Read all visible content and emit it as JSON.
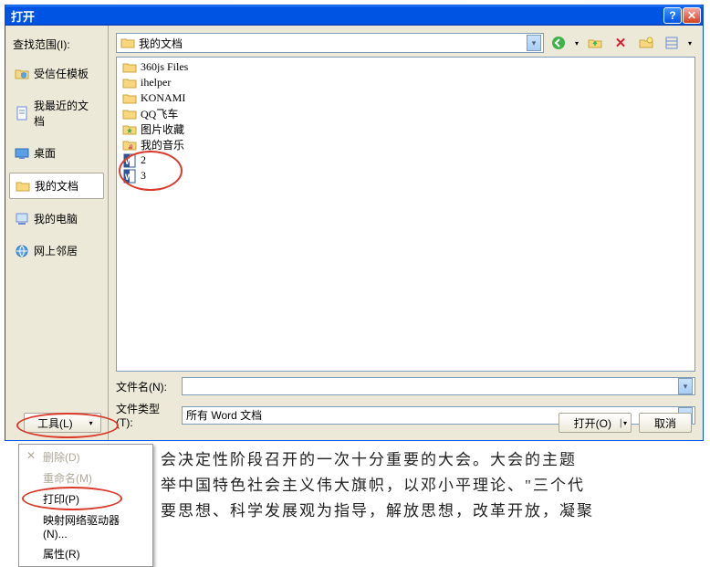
{
  "title": "打开",
  "lookup_label": "查找范围(I):",
  "location": "我的文档",
  "left_items": [
    {
      "name": "trusted-templates",
      "label": "受信任模板",
      "icon": "folder-shield"
    },
    {
      "name": "recent-docs",
      "label": "我最近的文档",
      "icon": "doc"
    },
    {
      "name": "desktop",
      "label": "桌面",
      "icon": "desktop"
    },
    {
      "name": "my-docs",
      "label": "我的文档",
      "icon": "folder",
      "selected": true
    },
    {
      "name": "my-computer",
      "label": "我的电脑",
      "icon": "computer"
    },
    {
      "name": "network",
      "label": "网上邻居",
      "icon": "network"
    }
  ],
  "files": [
    {
      "type": "folder",
      "name": "360js Files"
    },
    {
      "type": "folder",
      "name": "ihelper"
    },
    {
      "type": "folder",
      "name": "KONAMI"
    },
    {
      "type": "folder",
      "name": "QQ飞车"
    },
    {
      "type": "folder-star",
      "name": "图片收藏"
    },
    {
      "type": "folder-music",
      "name": "我的音乐"
    },
    {
      "type": "word",
      "name": "2"
    },
    {
      "type": "word",
      "name": "3"
    }
  ],
  "filename_label": "文件名(N):",
  "filename_value": "",
  "filetype_label": "文件类型(T):",
  "filetype_value": "所有 Word 文档",
  "open_label": "打开(O)",
  "cancel_label": "取消",
  "tools_label": "工具(L)",
  "context_menu": [
    {
      "label": "删除(D)",
      "disabled": true,
      "x": true
    },
    {
      "label": "重命名(M)",
      "disabled": true
    },
    {
      "label": "打印(P)",
      "disabled": false
    },
    {
      "label": "映射网络驱动器(N)...",
      "disabled": false
    },
    {
      "label": "属性(R)",
      "disabled": false
    }
  ],
  "bg_lines": [
    "会决定性阶段召开的一次十分重要的大会。大会的主题",
    "举中国特色社会主义伟大旗帜，以邓小平理论、\"三个代",
    "要思想、科学发展观为指导，解放思想，改革开放，凝聚"
  ],
  "toolbar_icons": [
    "back",
    "up",
    "delete",
    "new-folder",
    "views"
  ]
}
